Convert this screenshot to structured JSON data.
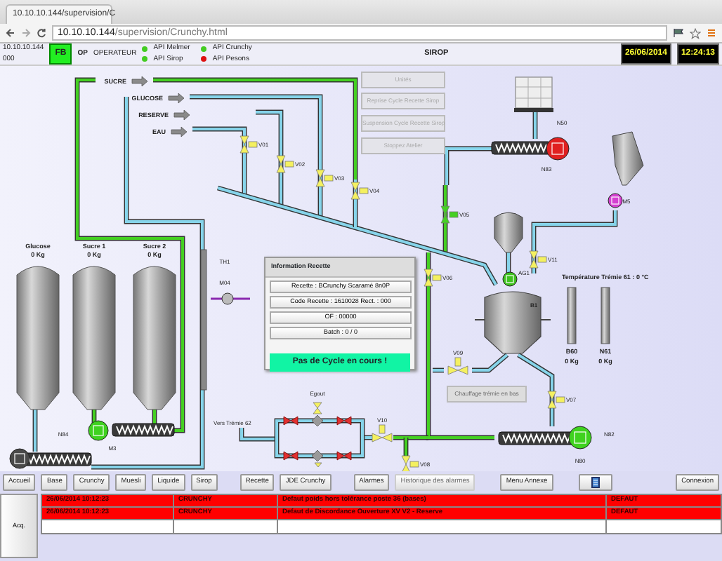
{
  "browser": {
    "tab_title": "10.10.10.144/supervision/C",
    "url": "10.10.10.144/supervision/Crunchy.html"
  },
  "header": {
    "ip": "10.10.10.144",
    "code": "000",
    "mode_badge": "FB",
    "role": "OP",
    "user": "OPERATEUR",
    "title": "SIROP",
    "date": "26/06/2014",
    "time": "12:24:13"
  },
  "plc_status": [
    {
      "label": "API Melmer",
      "color": "#44cc22"
    },
    {
      "label": "API Sirop",
      "color": "#44cc22"
    },
    {
      "label": "API Crunchy",
      "color": "#44cc22"
    },
    {
      "label": "API Pesons",
      "color": "#dd1111"
    }
  ],
  "command_buttons": [
    {
      "label": "Unités",
      "disabled": true
    },
    {
      "label": "Reprise Cycle Recette Sirop",
      "disabled": true
    },
    {
      "label": "Suspension Cycle Recette Sirop",
      "disabled": true
    },
    {
      "label": "Stoppez Atelier",
      "disabled": true
    }
  ],
  "feeds": [
    "SUCRE",
    "GLUCOSE",
    "RESERVE",
    "EAU"
  ],
  "valves": [
    {
      "label": "V01",
      "open": false
    },
    {
      "label": "V02",
      "open": false
    },
    {
      "label": "V03",
      "open": false
    },
    {
      "label": "V04",
      "open": false
    },
    {
      "label": "V05",
      "open": true
    },
    {
      "label": "V06",
      "open": false
    },
    {
      "label": "V07",
      "open": false
    },
    {
      "label": "V08",
      "open": false
    },
    {
      "label": "V09",
      "open": false
    },
    {
      "label": "V10",
      "open": false
    },
    {
      "label": "V11",
      "open": false
    }
  ],
  "motors": [
    {
      "label": "N83",
      "color": "#e02020"
    },
    {
      "label": "M5",
      "color": "#d43fd0"
    },
    {
      "label": "AG1",
      "color": "#3fc21f"
    },
    {
      "label": "N80",
      "color": "#3fd21f"
    },
    {
      "label": "M3",
      "color": "#3fd21f"
    },
    {
      "label": "N84",
      "color": "#4a4a4a"
    }
  ],
  "silos": [
    {
      "name": "Glucose",
      "weight": "0 Kg"
    },
    {
      "name": "Sucre 1",
      "weight": "0 Kg"
    },
    {
      "name": "Sucre 2",
      "weight": "0 Kg"
    }
  ],
  "bins": [
    {
      "name": "B60",
      "weight": "0 Kg"
    },
    {
      "name": "N61",
      "weight": "0 Kg"
    }
  ],
  "tags": {
    "container": "N50",
    "exchanger": "TH1",
    "pump": "M04",
    "drain": "Egout",
    "destination": "Vers Trémie 62",
    "conveyor": "N82",
    "reactor": "B1",
    "temperature": "Température Trémie 61 : 0 °C"
  },
  "heating_button": {
    "label": "Chauffage trémie en bas",
    "disabled": true
  },
  "info_panel": {
    "title": "Information Recette",
    "lines": [
      "Recette : BCrunchy Scaramé 8n0P",
      "Code Recette : 1610028 Rect. : 000",
      "OF : 00000",
      "Batch : 0 / 0"
    ],
    "status": "Pas de Cycle en cours !"
  },
  "nav_groups": [
    [
      {
        "label": "Accueil",
        "disabled": false
      },
      {
        "label": "Base",
        "disabled": false
      },
      {
        "label": "Crunchy",
        "disabled": false
      },
      {
        "label": "Muesli",
        "disabled": false
      },
      {
        "label": "Liquide",
        "disabled": false
      },
      {
        "label": "Sirop",
        "disabled": false
      }
    ],
    [
      {
        "label": "Recette",
        "disabled": false
      },
      {
        "label": "JDE Crunchy",
        "disabled": false
      }
    ],
    [
      {
        "label": "Alarmes",
        "disabled": false
      },
      {
        "label": "Historique des alarmes",
        "disabled": true
      }
    ],
    [
      {
        "label": "Menu Annexe",
        "disabled": false
      }
    ],
    [
      {
        "kind": "icon",
        "disabled": false
      }
    ]
  ],
  "connect_button": "Connexion",
  "alarms": {
    "ack_label": "Acq.",
    "rows": [
      {
        "date": "26/06/2014 10:12:23",
        "unit": "CRUNCHY",
        "message": "Defaut poids hors tolérance poste 36 (bases)",
        "state": "DEFAUT",
        "active": true
      },
      {
        "date": "26/06/2014 10:12:23",
        "unit": "CRUNCHY",
        "message": "Defaut de Discordance Ouverture XV V2 - Reserve",
        "state": "DEFAUT",
        "active": true
      }
    ]
  }
}
